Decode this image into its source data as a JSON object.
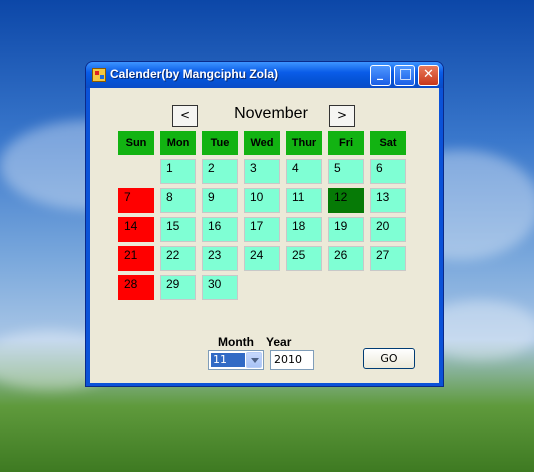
{
  "window": {
    "title": "Calender(by Mangciphu Zola)",
    "minimize_glyph": "_",
    "maximize_glyph": "□",
    "close_glyph": "✕"
  },
  "calendar": {
    "prev_label": "<",
    "next_label": ">",
    "month_name": "November",
    "weekdays": [
      "Sun",
      "Mon",
      "Tue",
      "Wed",
      "Thur",
      "Fri",
      "Sat"
    ],
    "days": [
      "1",
      "2",
      "3",
      "4",
      "5",
      "6",
      "7",
      "8",
      "9",
      "10",
      "11",
      "12",
      "13",
      "14",
      "15",
      "16",
      "17",
      "18",
      "19",
      "20",
      "21",
      "22",
      "23",
      "24",
      "25",
      "26",
      "27",
      "28",
      "29",
      "30"
    ],
    "highlighted_day": "12",
    "colors": {
      "header": "#12b312",
      "day": "#7fffd4",
      "sunday": "#ff0000",
      "today": "#067a06"
    }
  },
  "controls": {
    "month_label": "Month",
    "year_label": "Year",
    "month_value": "11",
    "year_value": "2010",
    "go_label": "GO"
  }
}
